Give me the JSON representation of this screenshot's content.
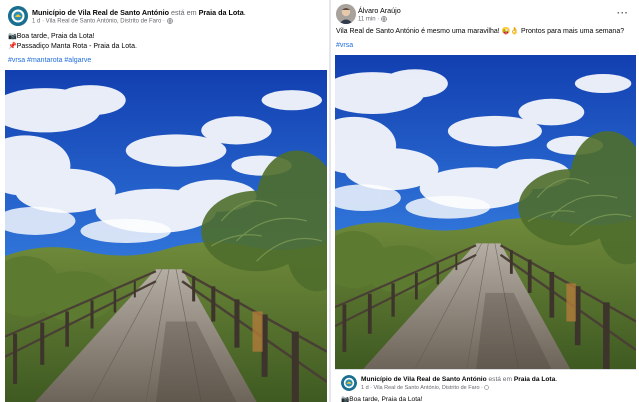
{
  "left_post": {
    "author": "Município de Vila Real de Santo António",
    "connector": "está em",
    "location": "Praia da Lota",
    "meta": "1 d · Vila Real de Santo António, Distrito de Faro · ",
    "lines": [
      "📷Boa tarde, Praia da Lota!",
      "📌Passadiço Manta Rota - Praia da Lota."
    ],
    "hashtags": "#vrsa #mantarota #algarve"
  },
  "right_post": {
    "author": "Álvaro Araújo",
    "meta": "11 min · ",
    "text": "Vila Real de Santo António é mesmo uma maravilha! 😜👌 Prontos para mais uma semana?",
    "hashtags": "#vrsa",
    "more_label": "···"
  },
  "shared_post": {
    "author": "Município de Vila Real de Santo António",
    "connector": "está em",
    "location": "Praia da Lota",
    "meta": "1 d · Vila Real de Santo António, Distrito de Faro · ",
    "line1": "📷Boa tarde, Praia da Lota!"
  },
  "colors": {
    "link": "#216fdb",
    "muted": "#65676b",
    "sky_top": "#1a47b8",
    "boardwalk": "#8a7f73"
  }
}
